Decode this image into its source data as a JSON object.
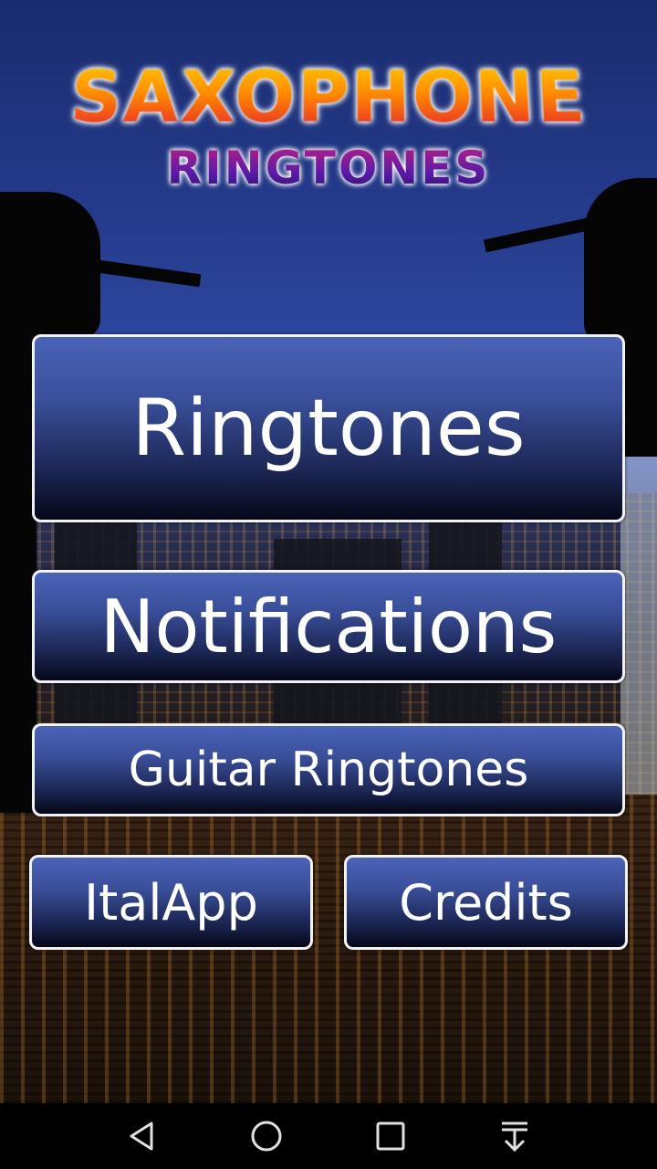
{
  "logo": {
    "line1": "SAXOPHONE",
    "line2": "RINGTONES"
  },
  "menu": {
    "ringtones": "Ringtones",
    "notifications": "Notifications",
    "guitar_ringtones": "Guitar Ringtones",
    "italapp": "ItalApp",
    "credits": "Credits"
  },
  "navbar": {
    "icons": [
      "back-icon",
      "home-icon",
      "recents-icon",
      "notifications-pull-icon"
    ]
  },
  "colors": {
    "button_top": "#4a63b8",
    "button_bottom": "#050818",
    "button_border": "#f2f2f2"
  }
}
